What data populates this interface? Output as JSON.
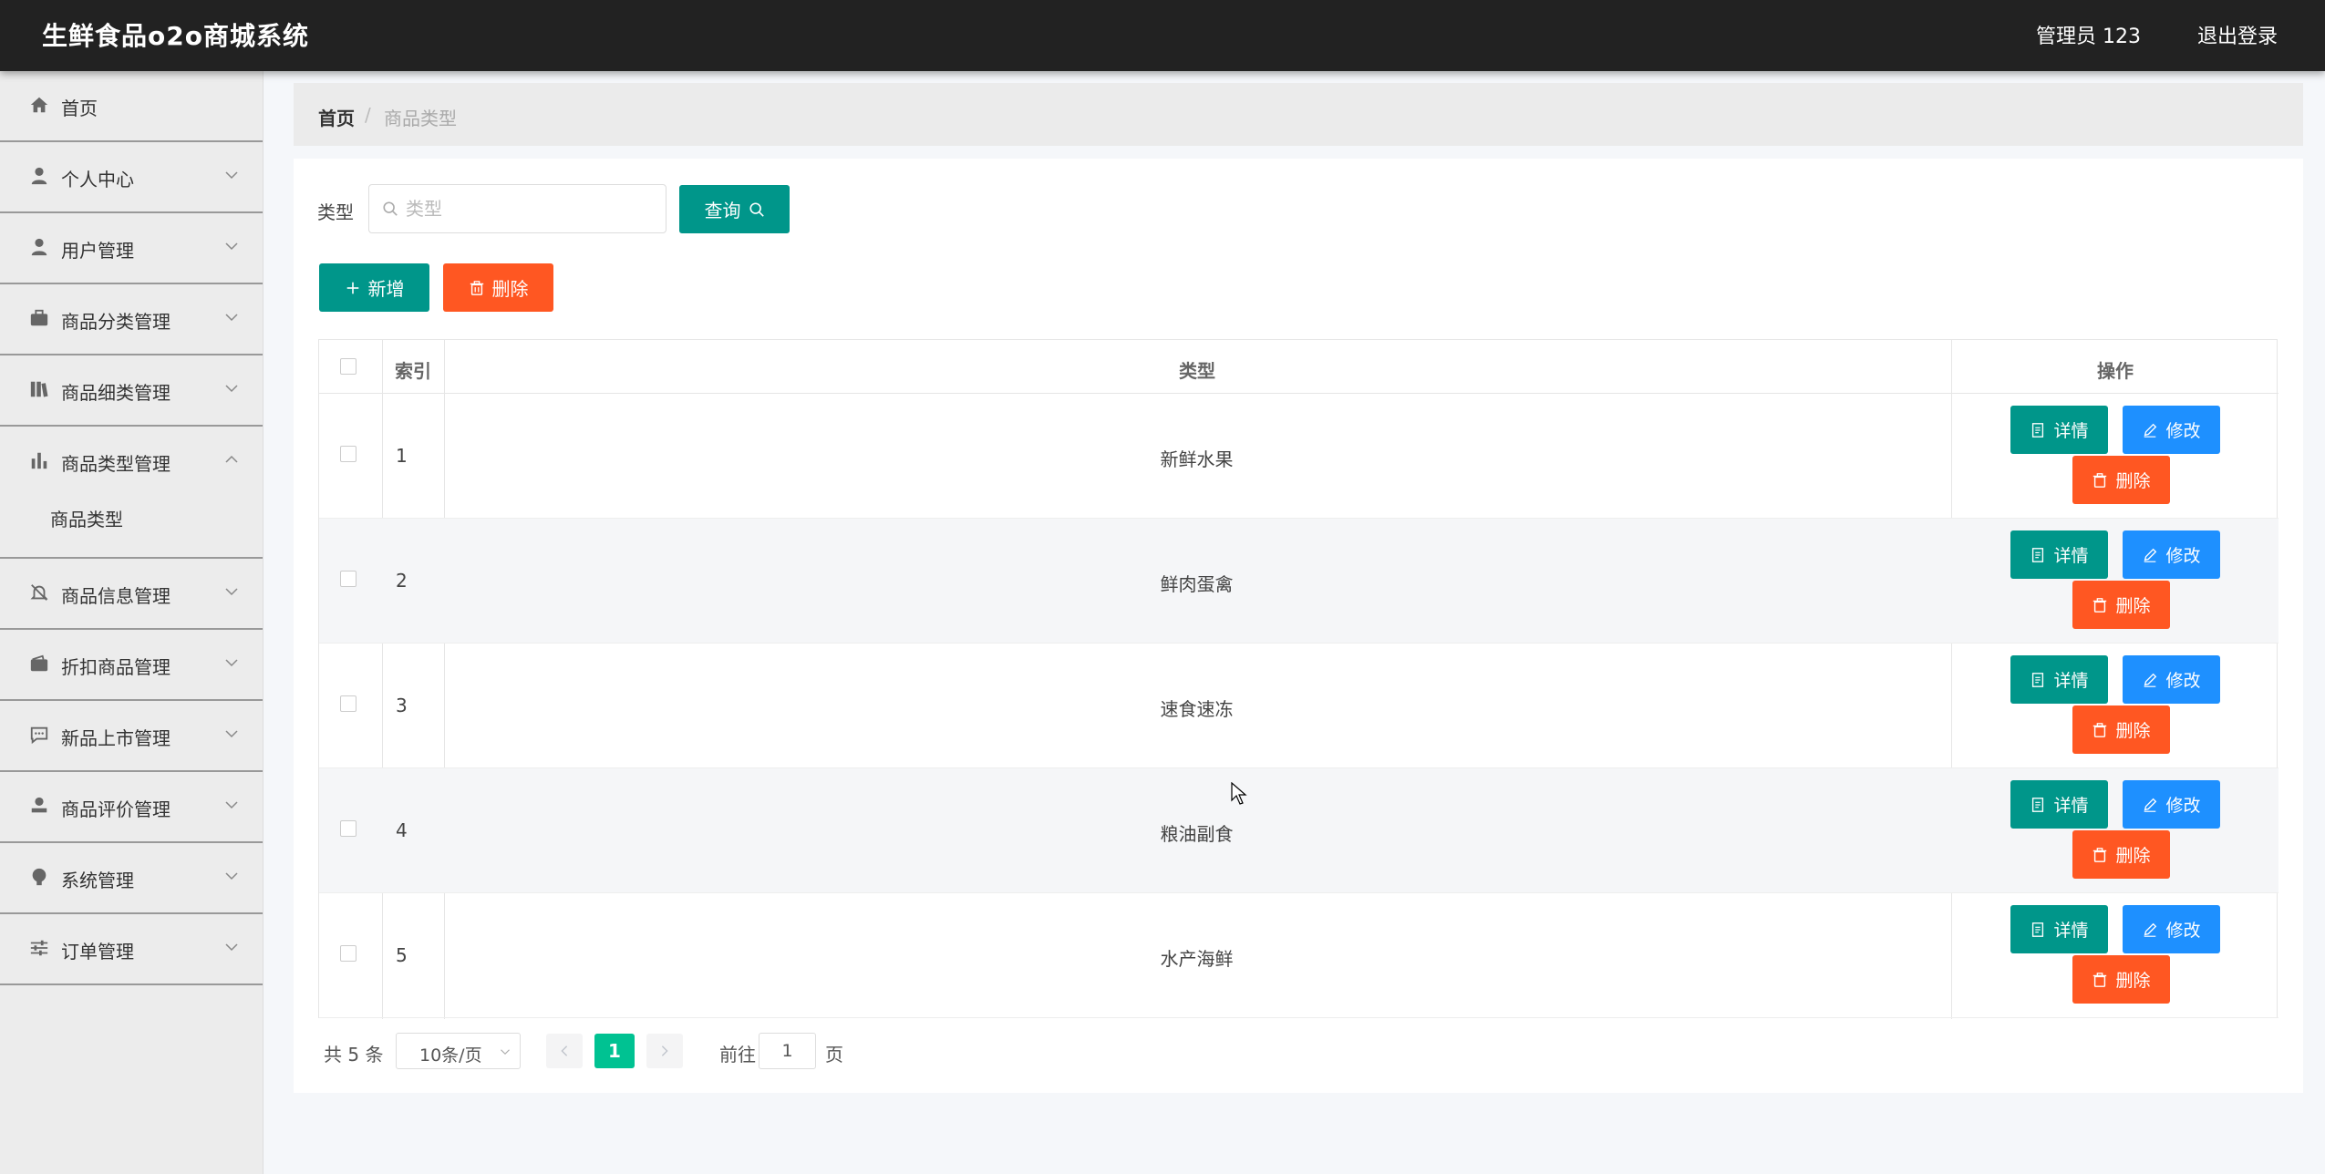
{
  "app": {
    "title": "生鲜食品o2o商城系统",
    "user": "管理员 123",
    "logout": "退出登录"
  },
  "sidebar": {
    "items": [
      {
        "label": "首页",
        "icon": "home-icon"
      },
      {
        "label": "个人中心",
        "icon": "user-icon"
      },
      {
        "label": "用户管理",
        "icon": "user-icon"
      },
      {
        "label": "商品分类管理",
        "icon": "briefcase-icon"
      },
      {
        "label": "商品细类管理",
        "icon": "books-icon"
      },
      {
        "label": "商品类型管理",
        "icon": "bar-chart-icon",
        "expanded": true,
        "children": [
          {
            "label": "商品类型"
          }
        ]
      },
      {
        "label": "商品信息管理",
        "icon": "bell-off-icon"
      },
      {
        "label": "折扣商品管理",
        "icon": "wallet-icon"
      },
      {
        "label": "新品上市管理",
        "icon": "chat-icon"
      },
      {
        "label": "商品评价管理",
        "icon": "stamp-icon"
      },
      {
        "label": "系统管理",
        "icon": "bulb-icon"
      },
      {
        "label": "订单管理",
        "icon": "sliders-icon"
      }
    ]
  },
  "breadcrumb": {
    "home": "首页",
    "separator": "/",
    "current": "商品类型"
  },
  "filter": {
    "label": "类型",
    "placeholder": "类型",
    "search_button": "查询"
  },
  "actions": {
    "add": "新增",
    "delete": "删除"
  },
  "table": {
    "columns": {
      "index": "索引",
      "type": "类型",
      "ops": "操作"
    },
    "row_buttons": {
      "detail": "详情",
      "edit": "修改",
      "delete": "删除"
    },
    "rows": [
      {
        "index": "1",
        "type": "新鲜水果"
      },
      {
        "index": "2",
        "type": "鲜肉蛋禽"
      },
      {
        "index": "3",
        "type": "速食速冻"
      },
      {
        "index": "4",
        "type": "粮油副食"
      },
      {
        "index": "5",
        "type": "水产海鲜"
      }
    ]
  },
  "pagination": {
    "total": "共 5 条",
    "page_size": "10条/页",
    "current_page": "1",
    "goto_label": "前往",
    "goto_value": "1",
    "page_suffix": "页"
  },
  "colors": {
    "primary": "#00968a",
    "danger": "#ff5722",
    "info": "#1e90ff",
    "pager_active": "#00c292",
    "topbar": "#222222"
  }
}
